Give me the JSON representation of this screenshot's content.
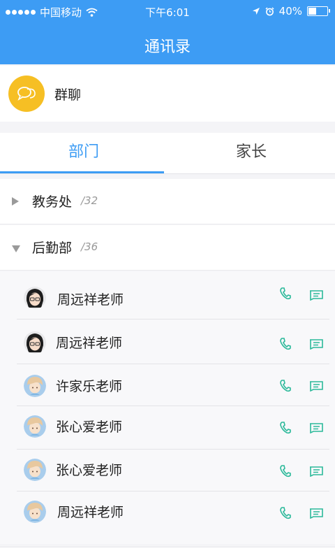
{
  "status_bar": {
    "carrier": "中国移动",
    "time": "下午6:01",
    "battery": "40%",
    "battery_level": 0.4
  },
  "nav": {
    "title": "通讯录"
  },
  "group_chat": {
    "label": "群聊",
    "icon": "chat-bubbles-icon",
    "color": "#f6bf24"
  },
  "tabs": [
    {
      "label": "部门",
      "active": true
    },
    {
      "label": "家长",
      "active": false
    }
  ],
  "departments": [
    {
      "name": "教务处",
      "count": "/32",
      "expanded": false
    },
    {
      "name": "后勤部",
      "count": "/36",
      "expanded": true
    }
  ],
  "members": [
    {
      "name": "周远祥老师",
      "avatar": "girl-avatar"
    },
    {
      "name": "周远祥老师",
      "avatar": "girl-avatar"
    },
    {
      "name": "许家乐老师",
      "avatar": "boy-avatar"
    },
    {
      "name": "张心爱老师",
      "avatar": "boy-avatar"
    },
    {
      "name": "张心爱老师",
      "avatar": "boy-avatar"
    },
    {
      "name": "周远祥老师",
      "avatar": "boy-avatar"
    }
  ],
  "colors": {
    "primary": "#3d9cf4",
    "action_icons": "#2cb99a"
  }
}
